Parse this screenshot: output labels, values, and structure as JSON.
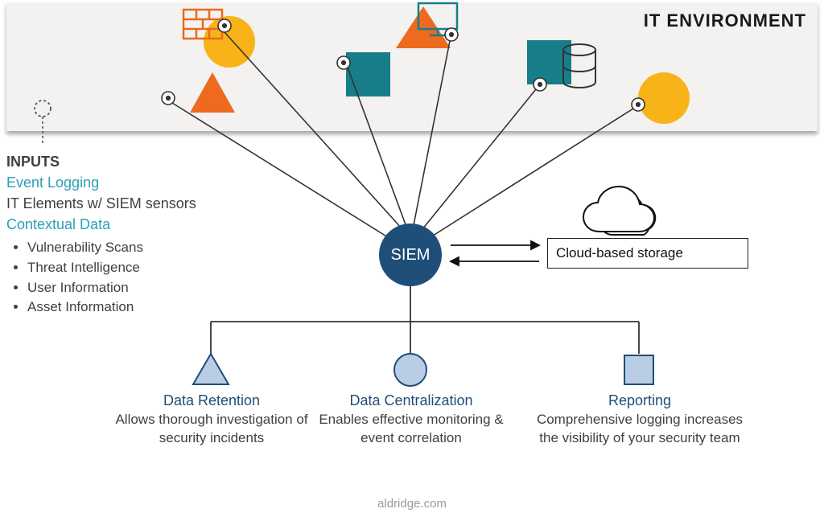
{
  "header": {
    "env_title": "IT ENVIRONMENT"
  },
  "siem": {
    "label": "SIEM"
  },
  "cloud": {
    "label": "Cloud-based storage"
  },
  "inputs": {
    "title": "INPUTS",
    "event_logging": "Event Logging",
    "sensors": "IT Elements w/ SIEM sensors",
    "contextual": "Contextual Data",
    "bullets": [
      "Vulnerability Scans",
      "Threat Intelligence",
      "User Information",
      "Asset Information"
    ]
  },
  "features": {
    "retention": {
      "title": "Data Retention",
      "desc": "Allows thorough investigation of security incidents"
    },
    "centralization": {
      "title": "Data Centralization",
      "desc": "Enables effective monitoring & event correlation"
    },
    "reporting": {
      "title": "Reporting",
      "desc": "Comprehensive logging increases the visibility of your security team"
    }
  },
  "footer": {
    "site": "aldridge.com"
  },
  "colors": {
    "yellow": "#f8b319",
    "teal": "#177e89",
    "orange": "#ed6a1f",
    "lightblue": "#b9cde5",
    "darkblue": "#1f4e79",
    "line": "#333333"
  }
}
